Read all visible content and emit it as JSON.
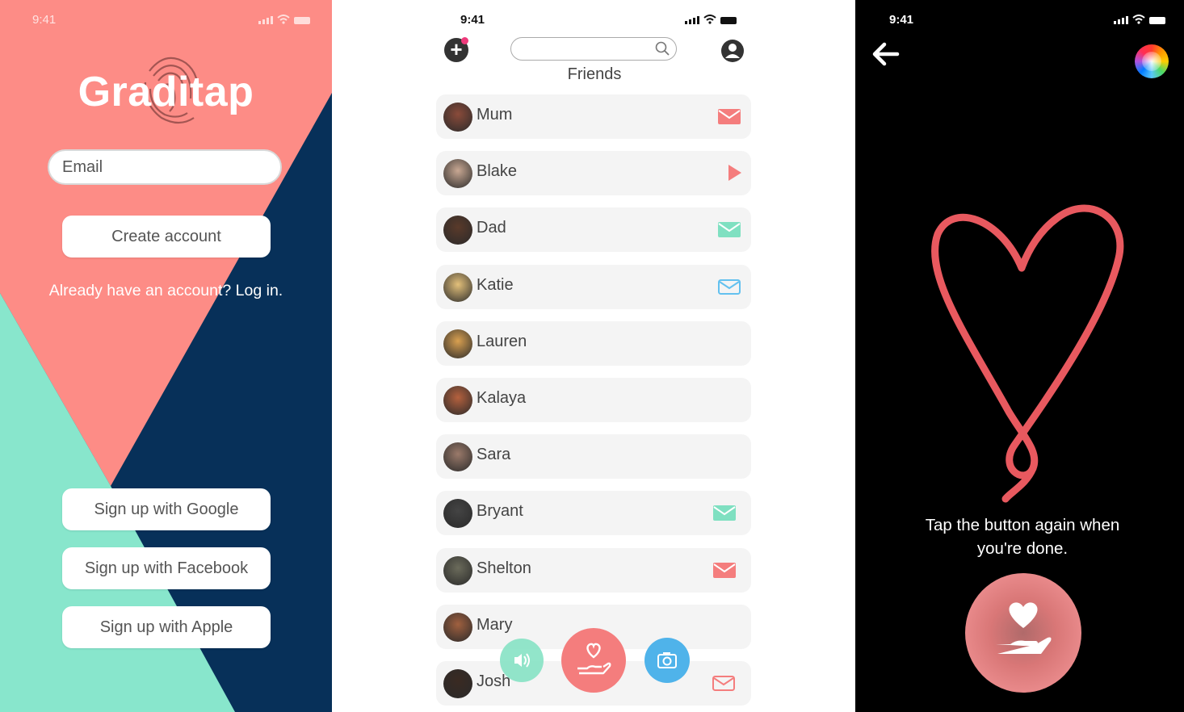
{
  "status": {
    "time": "9:41"
  },
  "signup": {
    "app_name": "Graditap",
    "email_placeholder": "Email",
    "create_account": "Create account",
    "login_prompt": "Already have an account? Log in.",
    "google": "Sign up with Google",
    "facebook": "Sign up with Facebook",
    "apple": "Sign up with Apple",
    "colors": {
      "coral": "#fd8c86",
      "navy": "#073059",
      "mint": "#88e6cc"
    }
  },
  "friends": {
    "title": "Friends",
    "items": [
      {
        "name": "Mum",
        "icon": "mail-icon",
        "icon_color": "#f47d7d"
      },
      {
        "name": "Blake",
        "icon": "play-icon",
        "icon_color": "#f47d7d"
      },
      {
        "name": "Dad",
        "icon": "mail-icon",
        "icon_color": "#7fe0c1"
      },
      {
        "name": "Katie",
        "icon": "mail-outline-icon",
        "icon_color": "#63c1ef"
      },
      {
        "name": "Lauren",
        "icon": "",
        "icon_color": ""
      },
      {
        "name": "Kalaya",
        "icon": "",
        "icon_color": ""
      },
      {
        "name": "Sara",
        "icon": "",
        "icon_color": ""
      },
      {
        "name": "Bryant",
        "icon": "mail-icon",
        "icon_color": "#7fe0c1"
      },
      {
        "name": "Shelton",
        "icon": "mail-icon",
        "icon_color": "#f47d7d"
      },
      {
        "name": "Mary",
        "icon": "",
        "icon_color": ""
      },
      {
        "name": "Josh",
        "icon": "mail-outline-icon",
        "icon_color": "#f47d7d"
      }
    ],
    "colors": {
      "coral": "#f47d7d",
      "mint": "#7fe0c1",
      "blue": "#4fb3ea"
    }
  },
  "draw": {
    "instruction_line1": "Tap the button again when",
    "instruction_line2": "you're done.",
    "colors": {
      "stroke": "#e8595f",
      "button": "#d97777"
    }
  }
}
